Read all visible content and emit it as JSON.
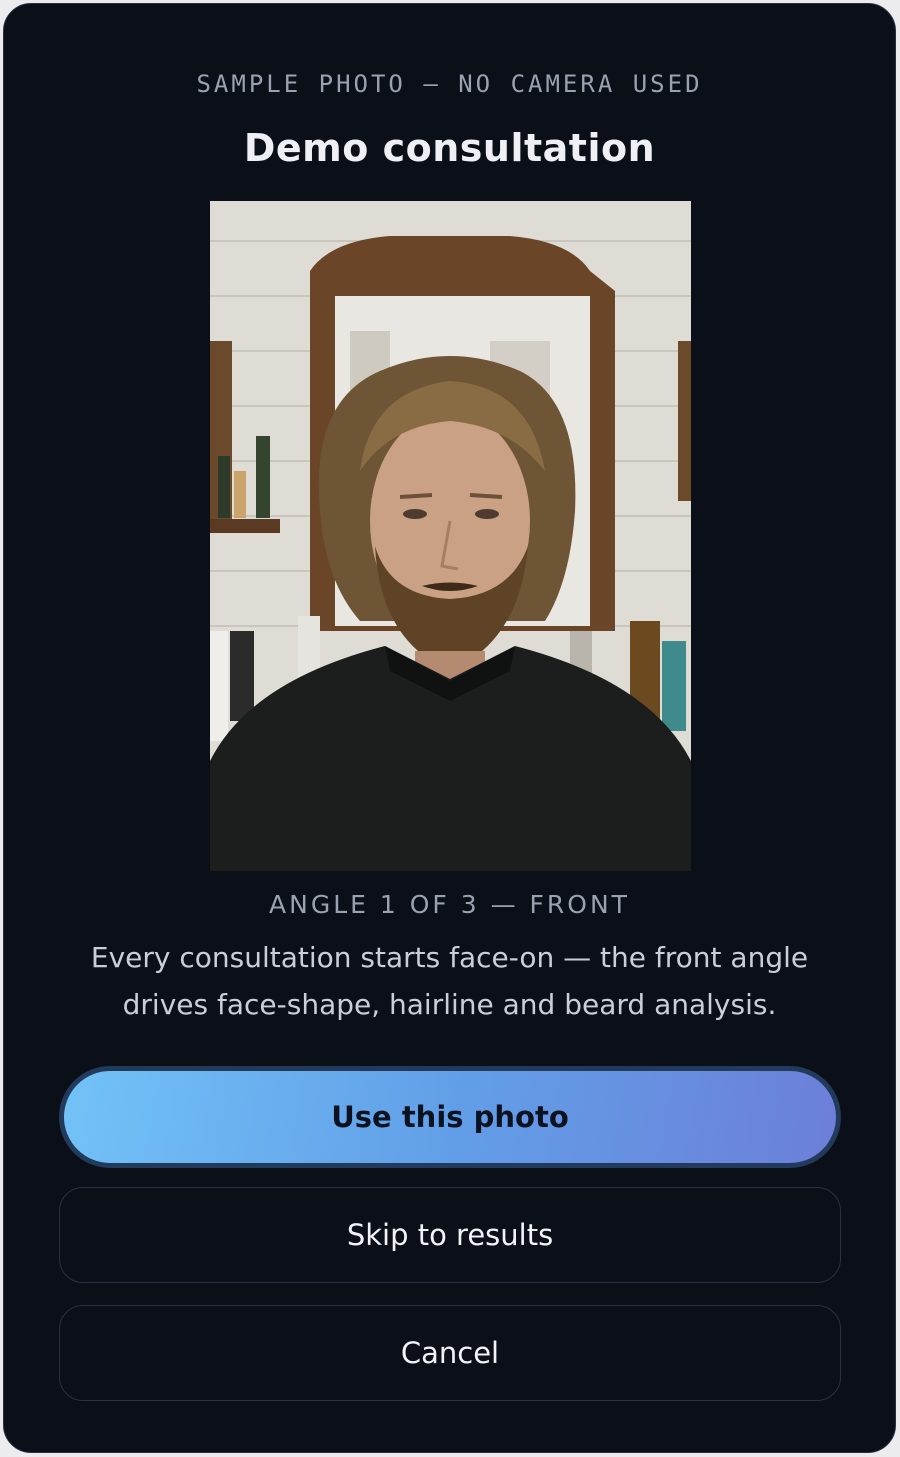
{
  "dialog": {
    "eyebrow": "SAMPLE PHOTO — NO CAMERA USED",
    "title": "Demo consultation",
    "photo_caption": "ANGLE 1 OF 3 — FRONT",
    "description": "Every consultation starts face-on — the front angle drives face-shape, hairline and beard analysis."
  },
  "actions": {
    "use_photo_label": "Use this photo",
    "skip_label": "Skip to results",
    "cancel_label": "Cancel"
  },
  "colors": {
    "background": "#0b0f18",
    "primary_gradient_start": "#72c2f7",
    "primary_gradient_end": "#6c7fd9",
    "muted_text": "#9aa2b1"
  }
}
